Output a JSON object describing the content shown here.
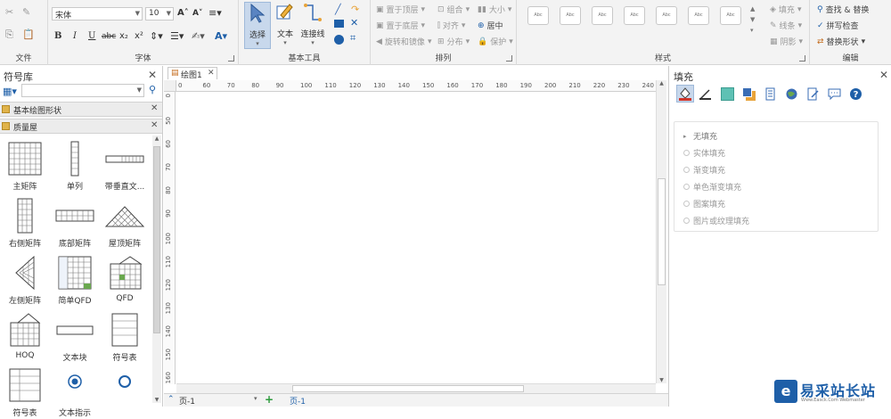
{
  "ribbon": {
    "file_group": {
      "label": "文件"
    },
    "font_group": {
      "label": "字体",
      "font_name": "宋体",
      "font_size": "10"
    },
    "basic_tools_group": {
      "label": "基本工具",
      "select": "选择",
      "text": "文本",
      "connector": "连接线"
    },
    "arrange_group": {
      "label": "排列",
      "bring_front": "置于顶层",
      "send_back": "置于底层",
      "rotate_flip": "旋转和镜像",
      "group": "组合",
      "align": "对齐",
      "distribute": "分布",
      "size": "大小",
      "center": "居中",
      "protect": "保护"
    },
    "style_group": {
      "label": "样式",
      "swatch_text": "Abc",
      "fill": "填充",
      "line": "线条",
      "shadow": "阴影"
    },
    "edit_group": {
      "label": "编辑",
      "find_replace": "查找 & 替换",
      "spellcheck": "拼写检查",
      "replace_shape": "替换形状"
    }
  },
  "library": {
    "title": "符号库",
    "sections": [
      {
        "label": "基本绘图形状"
      },
      {
        "label": "质量屋"
      }
    ],
    "shapes": [
      {
        "label": "主矩阵"
      },
      {
        "label": "单列"
      },
      {
        "label": "带垂直文..."
      },
      {
        "label": "右侧矩阵"
      },
      {
        "label": "底部矩阵"
      },
      {
        "label": "屋顶矩阵"
      },
      {
        "label": "左侧矩阵"
      },
      {
        "label": "简单QFD"
      },
      {
        "label": "QFD"
      },
      {
        "label": "HOQ"
      },
      {
        "label": "文本块"
      },
      {
        "label": "符号表"
      },
      {
        "label": "符号表"
      },
      {
        "label": "文本指示"
      },
      {
        "label": ""
      }
    ]
  },
  "document": {
    "tab": "绘图1",
    "ruler_h": [
      "0",
      "60",
      "70",
      "80",
      "90",
      "100",
      "110",
      "120",
      "130",
      "140",
      "150",
      "160",
      "170",
      "180",
      "190",
      "200",
      "210",
      "220",
      "230",
      "240"
    ],
    "ruler_v": [
      "0",
      "50",
      "60",
      "70",
      "80",
      "90",
      "100",
      "110",
      "120",
      "130",
      "140",
      "150",
      "160"
    ],
    "page_select": "页-1",
    "page_tab": "页-1"
  },
  "fill_panel": {
    "title": "填充",
    "options": [
      "无填充",
      "实体填充",
      "渐变填充",
      "单色渐变填充",
      "图案填充",
      "图片或纹理填充"
    ]
  },
  "watermark": {
    "text": "易采站长站",
    "sub": "Www.Easck.Com Webmaster"
  },
  "colors": {
    "accent": "#1e5fa8",
    "selected_tool": "#c8d8ec",
    "ribbon_bg": "#f3f3f3"
  }
}
